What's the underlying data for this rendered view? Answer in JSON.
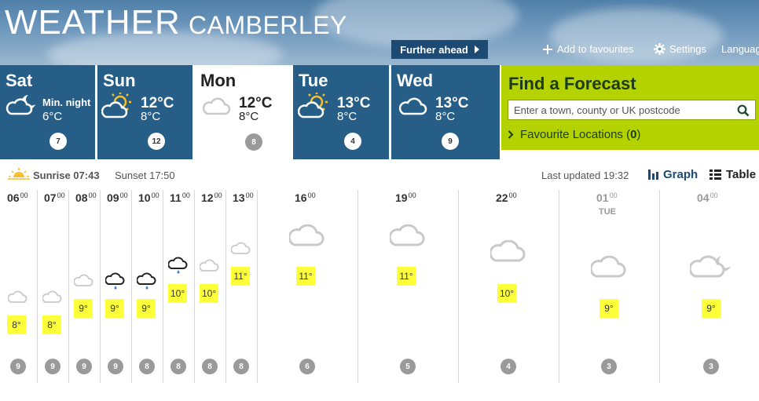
{
  "header": {
    "brand": "WEATHER",
    "location": "CAMBERLEY",
    "further_ahead": "Further ahead",
    "add_favourites": "Add to favourites",
    "settings": "Settings",
    "language": "Languag"
  },
  "days": [
    {
      "name": "Sat",
      "label": "Min. night",
      "low": "6°C",
      "wind": "7",
      "icon": "cloud-moon-icon"
    },
    {
      "name": "Sun",
      "high": "12°C",
      "low": "8°C",
      "wind": "12",
      "icon": "sun-cloud-icon"
    },
    {
      "name": "Mon",
      "high": "12°C",
      "low": "8°C",
      "wind": "8",
      "icon": "cloud-icon"
    },
    {
      "name": "Tue",
      "high": "13°C",
      "low": "8°C",
      "wind": "4",
      "icon": "sun-cloud-icon"
    },
    {
      "name": "Wed",
      "high": "13°C",
      "low": "8°C",
      "wind": "9",
      "icon": "cloud-icon"
    }
  ],
  "find": {
    "title": "Find a Forecast",
    "placeholder": "Enter a town, county or UK postcode",
    "favourites_label": "Favourite Locations (",
    "favourites_count": "0",
    "favourites_close": ")"
  },
  "info": {
    "sunrise": "Sunrise 07:43",
    "sunset": "Sunset 17:50",
    "last_updated": "Last updated 19:32",
    "graph": "Graph",
    "table": "Table"
  },
  "hours": [
    {
      "h": "06",
      "m": "00",
      "temp": "8°",
      "wind": "9",
      "icon": "cloud-icon"
    },
    {
      "h": "07",
      "m": "00",
      "temp": "8°",
      "wind": "9",
      "icon": "cloud-icon"
    },
    {
      "h": "08",
      "m": "00",
      "temp": "9°",
      "wind": "9",
      "icon": "cloud-icon"
    },
    {
      "h": "09",
      "m": "00",
      "temp": "9°",
      "wind": "9",
      "icon": "light-rain-icon"
    },
    {
      "h": "10",
      "m": "00",
      "temp": "9°",
      "wind": "8",
      "icon": "light-rain-icon"
    },
    {
      "h": "11",
      "m": "00",
      "temp": "10°",
      "wind": "8",
      "icon": "light-rain-icon"
    },
    {
      "h": "12",
      "m": "00",
      "temp": "10°",
      "wind": "8",
      "icon": "cloud-icon"
    },
    {
      "h": "13",
      "m": "00",
      "temp": "11°",
      "wind": "8",
      "icon": "cloud-icon"
    },
    {
      "h": "16",
      "m": "00",
      "temp": "11°",
      "wind": "6",
      "icon": "cloud-icon"
    },
    {
      "h": "19",
      "m": "00",
      "temp": "11°",
      "wind": "5",
      "icon": "cloud-icon"
    },
    {
      "h": "22",
      "m": "00",
      "temp": "10°",
      "wind": "4",
      "icon": "cloud-icon"
    },
    {
      "h": "01",
      "m": "00",
      "sub": "TUE",
      "temp": "9°",
      "wind": "3",
      "icon": "cloud-icon"
    },
    {
      "h": "04",
      "m": "00",
      "temp": "9°",
      "wind": "3",
      "icon": "cloud-moon-icon"
    }
  ]
}
